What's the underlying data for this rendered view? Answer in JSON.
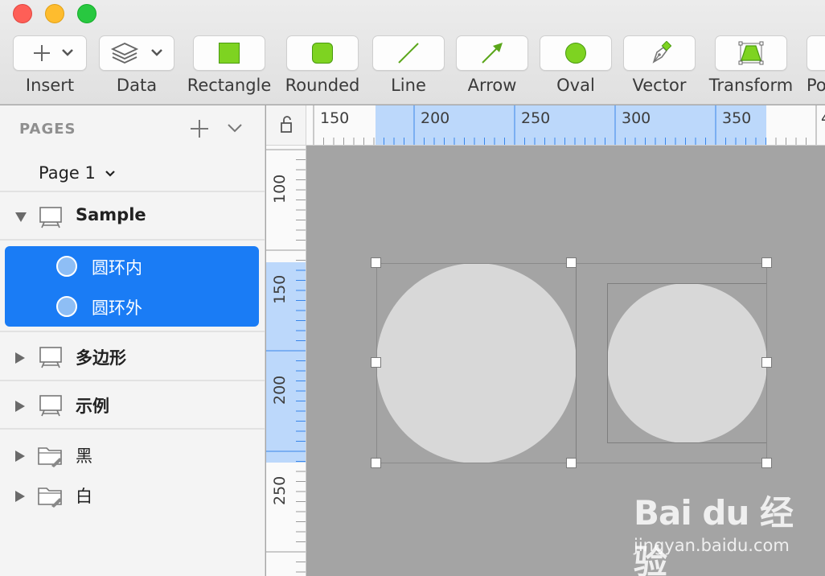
{
  "toolbar": {
    "tools": [
      {
        "label": "Insert",
        "icon": "plus-icon"
      },
      {
        "label": "Data",
        "icon": "layers-icon"
      },
      {
        "label": "Rectangle",
        "icon": "rectangle-icon"
      },
      {
        "label": "Rounded",
        "icon": "rounded-rectangle-icon"
      },
      {
        "label": "Line",
        "icon": "line-icon"
      },
      {
        "label": "Arrow",
        "icon": "arrow-icon"
      },
      {
        "label": "Oval",
        "icon": "oval-icon"
      },
      {
        "label": "Vector",
        "icon": "pen-icon"
      },
      {
        "label": "Transform",
        "icon": "transform-icon"
      },
      {
        "label": "Po",
        "icon": "unknown-icon"
      }
    ],
    "shape_color": "#7ed321"
  },
  "sidebar": {
    "pages_header": "PAGES",
    "current_page": "Page 1",
    "layers": [
      {
        "name": "Sample",
        "type": "artboard",
        "expanded": true
      },
      {
        "name": "多边形",
        "type": "artboard",
        "expanded": false
      },
      {
        "name": "示例",
        "type": "artboard",
        "expanded": false
      },
      {
        "name": "黑",
        "type": "folder",
        "expanded": false
      },
      {
        "name": "白",
        "type": "folder",
        "expanded": false
      }
    ],
    "selected_children": [
      "圆环内",
      "圆环外"
    ],
    "selection_color": "#1a7cf5"
  },
  "rulers": {
    "horizontal_labels": [
      "150",
      "200",
      "250",
      "300",
      "350",
      "4"
    ],
    "vertical_labels": [
      "100",
      "150",
      "200",
      "250"
    ],
    "highlight_color": "#bcd8fb"
  },
  "watermark": {
    "logo_text": "Bai du 经验",
    "url": "jingyan.baidu.com"
  }
}
